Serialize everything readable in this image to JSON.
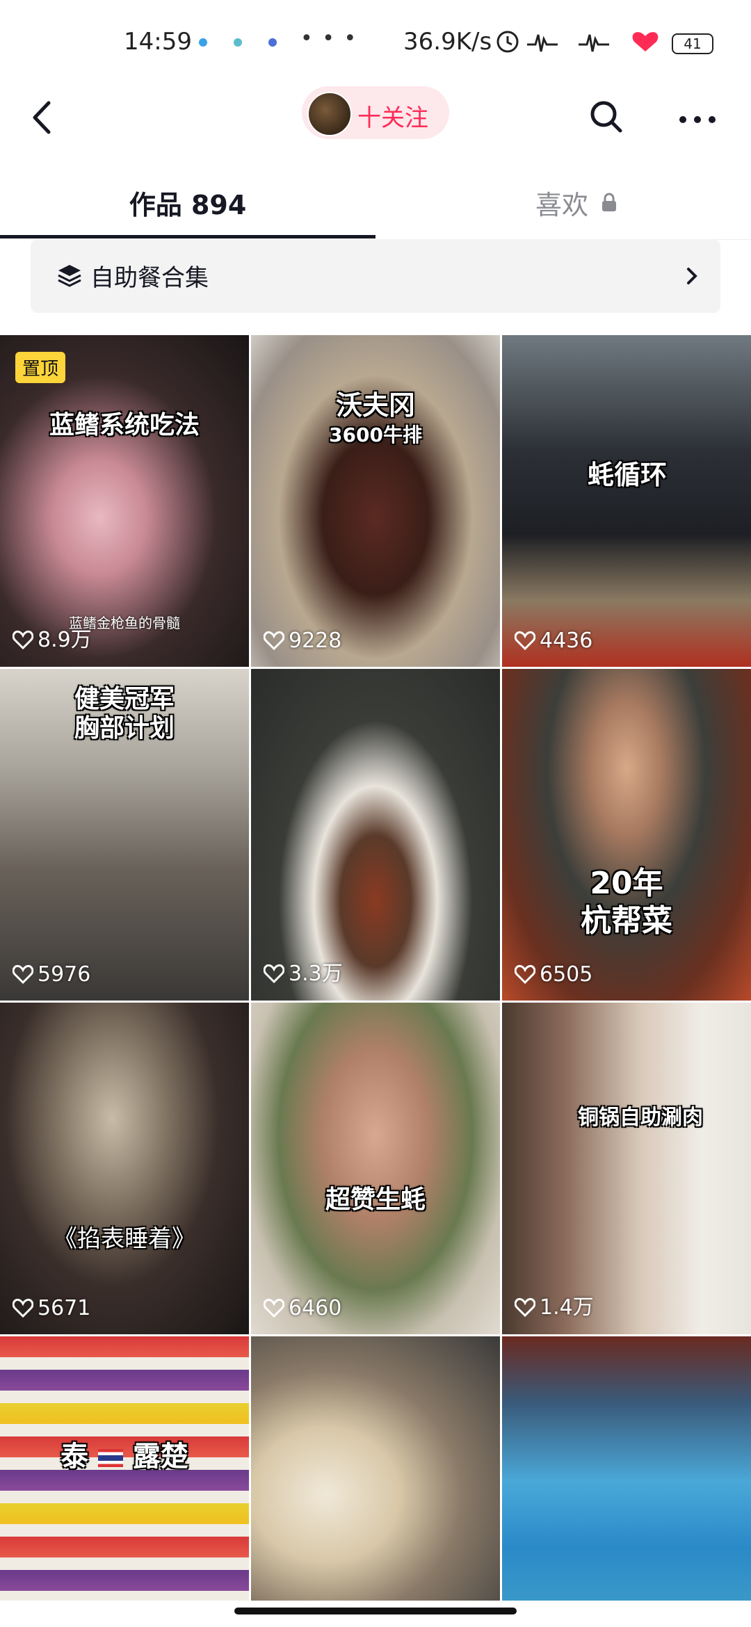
{
  "status_bar": {
    "time": "14:59",
    "more": "• • •",
    "net_speed": "36.9K/s",
    "battery": "41"
  },
  "nav": {
    "follow_label": "十关注"
  },
  "tabs": {
    "works_label": "作品 894",
    "likes_label": "喜欢"
  },
  "collection": {
    "label": "自助餐合集"
  },
  "grid": {
    "items": [
      {
        "caption": "蓝鳍系统吃法",
        "sub": "蓝鳍金枪鱼的骨髓",
        "badge": "置顶",
        "likes": "8.9万"
      },
      {
        "caption": "沃夫冈",
        "sub": "3600牛排",
        "likes": "9228"
      },
      {
        "caption": "蚝循环",
        "likes": "4436"
      },
      {
        "caption": "健美冠军",
        "sub": "胸部计划",
        "likes": "5976"
      },
      {
        "caption": "",
        "likes": "3.3万"
      },
      {
        "caption": "20年",
        "sub": "杭帮菜",
        "likes": "6505"
      },
      {
        "caption": "《掐表睡着》",
        "likes": "5671"
      },
      {
        "caption": "超赞生蚝",
        "likes": "6460"
      },
      {
        "caption": "铜锅自助涮肉",
        "likes": "1.4万"
      },
      {
        "caption": "泰",
        "sub": "露楚",
        "likes": ""
      },
      {
        "caption": "",
        "likes": ""
      },
      {
        "caption": "",
        "likes": ""
      }
    ]
  },
  "colors": {
    "accent": "#fe2c55",
    "pin_badge": "#fdd43a",
    "tab_active": "#161823",
    "tab_inactive": "#8a8b91"
  }
}
